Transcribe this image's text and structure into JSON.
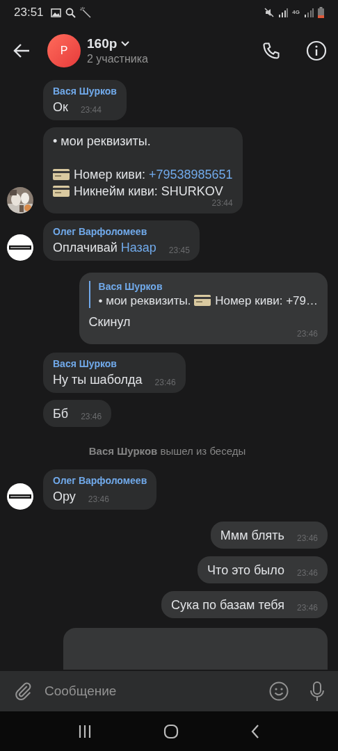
{
  "status_bar": {
    "time": "23:51",
    "network": "4G"
  },
  "header": {
    "avatar_letter": "Р",
    "title": "160р",
    "subtitle": "2 участника"
  },
  "messages": [
    {
      "kind": "incoming",
      "sender": "Вася Шурков",
      "paragraphs": [
        [
          [
            {
              "text": "Ок"
            }
          ]
        ]
      ],
      "time": "23:44"
    },
    {
      "kind": "incoming",
      "avatar": {
        "kind": "picture"
      },
      "paragraphs": [
        [
          [
            {
              "text": "• мои реквизиты."
            }
          ]
        ],
        [
          [
            {
              "card": true
            },
            {
              "text": "Номер киви: "
            },
            {
              "text": "+79538985651",
              "link": true
            }
          ],
          [
            {
              "card": true
            },
            {
              "text": "Никнейм киви: SHURKOV"
            }
          ]
        ]
      ],
      "time": "23:44"
    },
    {
      "kind": "incoming",
      "avatar": {
        "kind": "logo"
      },
      "sender": "Олег Варфоломеев",
      "paragraphs": [
        [
          [
            {
              "text": "Оплачивай "
            },
            {
              "text": "Назар",
              "link": true
            }
          ]
        ]
      ],
      "time": "23:45"
    },
    {
      "kind": "outgoing",
      "quote": {
        "sender": "Вася Шурков",
        "parts": [
          {
            "text": "• мои реквизиты. "
          },
          {
            "card": true
          },
          {
            "text": "Номер киви: +79…"
          }
        ]
      },
      "paragraphs": [
        [
          [
            {
              "text": "Скинул"
            }
          ]
        ]
      ],
      "time": "23:46"
    },
    {
      "kind": "incoming",
      "sender": "Вася Шурков",
      "paragraphs": [
        [
          [
            {
              "text": "Ну ты шаболда"
            }
          ]
        ]
      ],
      "time": "23:46"
    },
    {
      "kind": "incoming",
      "paragraphs": [
        [
          [
            {
              "text": "Бб"
            }
          ]
        ]
      ],
      "time": "23:46"
    },
    {
      "kind": "system",
      "actor": "Вася Шурков",
      "text": "вышел из беседы"
    },
    {
      "kind": "incoming",
      "avatar": {
        "kind": "logo"
      },
      "sender": "Олег Варфоломеев",
      "paragraphs": [
        [
          [
            {
              "text": "Ору"
            }
          ]
        ]
      ],
      "time": "23:46"
    },
    {
      "kind": "outgoing",
      "paragraphs": [
        [
          [
            {
              "text": "Ммм блять"
            }
          ]
        ]
      ],
      "time": "23:46"
    },
    {
      "kind": "outgoing",
      "paragraphs": [
        [
          [
            {
              "text": "Что это было"
            }
          ]
        ]
      ],
      "time": "23:46"
    },
    {
      "kind": "outgoing",
      "paragraphs": [
        [
          [
            {
              "text": "Сука по базам тебя"
            }
          ]
        ]
      ],
      "time": "23:46"
    },
    {
      "kind": "outgoing-cut"
    }
  ],
  "composer": {
    "placeholder": "Сообщение"
  }
}
